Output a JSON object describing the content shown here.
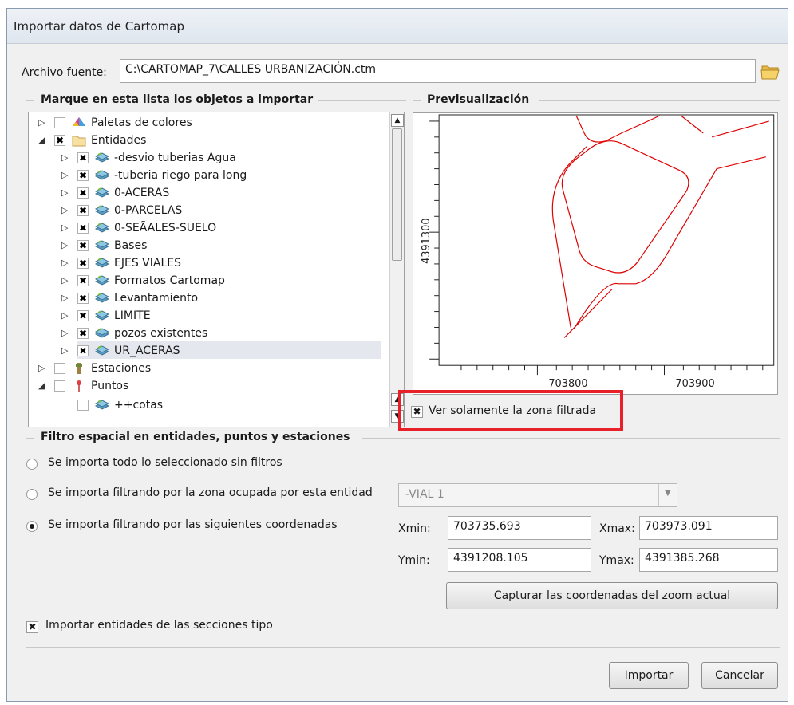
{
  "window": {
    "title": "Importar datos de Cartomap"
  },
  "source": {
    "label": "Archivo fuente:",
    "value": "C:\\CARTOMAP_7\\CALLES URBANIZACIÓN.ctm",
    "folder_icon": "folder-open-icon"
  },
  "objects_group": {
    "title": "Marque en esta lista los objetos a importar"
  },
  "preview_group": {
    "title": "Previsualización"
  },
  "tree": [
    {
      "label": "Paletas de colores",
      "level": 0,
      "expander": "▷",
      "checked": false,
      "icon": "palette-icon"
    },
    {
      "label": "Entidades",
      "level": 0,
      "expander": "◢",
      "checked": true,
      "icon": "folder-icon"
    },
    {
      "label": "-desvio tuberias Agua",
      "level": 1,
      "expander": "▷",
      "checked": true,
      "icon": "layers-icon"
    },
    {
      "label": "-tuberia riego para long",
      "level": 1,
      "expander": "▷",
      "checked": true,
      "icon": "layers-icon"
    },
    {
      "label": "0-ACERAS",
      "level": 1,
      "expander": "▷",
      "checked": true,
      "icon": "layers-icon"
    },
    {
      "label": "0-PARCELAS",
      "level": 1,
      "expander": "▷",
      "checked": true,
      "icon": "layers-icon"
    },
    {
      "label": "0-SEÃALES-SUELO",
      "level": 1,
      "expander": "▷",
      "checked": true,
      "icon": "layers-icon"
    },
    {
      "label": "Bases",
      "level": 1,
      "expander": "▷",
      "checked": true,
      "icon": "layers-icon"
    },
    {
      "label": "EJES VIALES",
      "level": 1,
      "expander": "▷",
      "checked": true,
      "icon": "layers-icon"
    },
    {
      "label": "Formatos Cartomap",
      "level": 1,
      "expander": "▷",
      "checked": true,
      "icon": "layers-icon"
    },
    {
      "label": "Levantamiento",
      "level": 1,
      "expander": "▷",
      "checked": true,
      "icon": "layers-icon"
    },
    {
      "label": "LIMITE",
      "level": 1,
      "expander": "▷",
      "checked": true,
      "icon": "layers-icon"
    },
    {
      "label": "pozos existentes",
      "level": 1,
      "expander": "▷",
      "checked": true,
      "icon": "layers-icon"
    },
    {
      "label": "UR_ACERAS",
      "level": 1,
      "expander": "▷",
      "checked": true,
      "icon": "layers-icon",
      "selected": true
    },
    {
      "label": "Estaciones",
      "level": 0,
      "expander": "▷",
      "checked": false,
      "icon": "station-icon"
    },
    {
      "label": "Puntos",
      "level": 0,
      "expander": "◢",
      "checked": false,
      "icon": "point-pin-icon"
    },
    {
      "label": "++cotas",
      "level": 1,
      "expander": "",
      "checked": false,
      "icon": "layers-icon"
    }
  ],
  "preview": {
    "x_ticks": [
      "703800",
      "703900"
    ],
    "y_ticks": [
      "4391300"
    ],
    "line_color": "#e00000"
  },
  "filter_zone_checkbox": {
    "label": "Ver solamente la zona filtrada",
    "checked": true,
    "highlight_color": "#e8202a"
  },
  "spatial_group": {
    "title": "Filtro espacial en entidades, puntos y estaciones"
  },
  "options": {
    "all": "Se importa todo lo seleccionado sin filtros",
    "by_entity": "Se importa filtrando por la zona ocupada por esta entidad",
    "by_coords": "Se importa filtrando por las siguientes coordenadas",
    "selected": "by_coords"
  },
  "entity_combo": {
    "value": "-VIAL 1"
  },
  "coords": {
    "xmin_label": "Xmin:",
    "xmin": "703735.693",
    "xmax_label": "Xmax:",
    "xmax": "703973.091",
    "ymin_label": "Ymin:",
    "ymin": "4391208.105",
    "ymax_label": "Ymax:",
    "ymax": "4391385.268"
  },
  "capture_button": "Capturar las coordenadas del zoom actual",
  "sections_checkbox": {
    "label": "Importar entidades de las secciones tipo",
    "checked": true
  },
  "buttons": {
    "import": "Importar",
    "cancel": "Cancelar"
  }
}
